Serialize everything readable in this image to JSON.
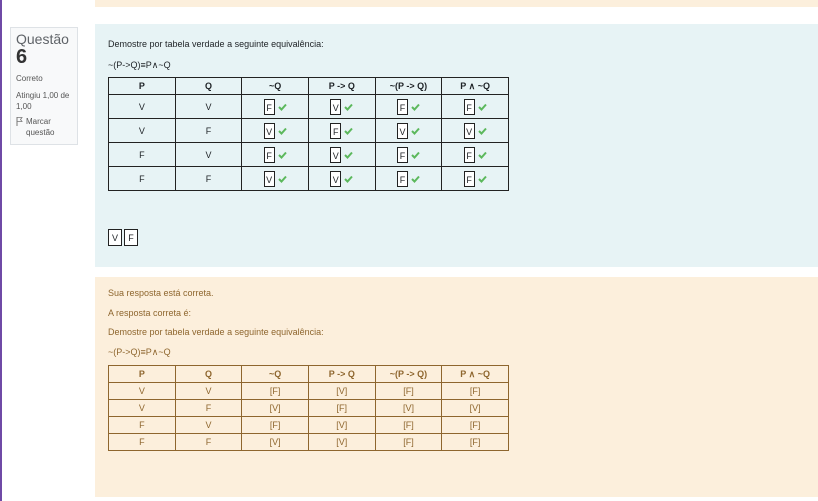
{
  "question_info": {
    "label": "Questão",
    "number": "6",
    "state": "Correto",
    "grade": "Atingiu 1,00 de 1,00",
    "flag_label": "Marcar questão",
    "flag_icon": "flag-icon"
  },
  "question": {
    "text": "Demostre por tabela verdade a seguinte equivalência:",
    "formula": "~(P->Q)≡P∧~Q",
    "headers": [
      "P",
      "Q",
      "~Q",
      "P -> Q",
      "~(P -> Q)",
      "P ∧ ~Q"
    ],
    "rows": [
      {
        "p": "V",
        "q": "V",
        "answers": [
          "F",
          "V",
          "F",
          "F"
        ]
      },
      {
        "p": "V",
        "q": "F",
        "answers": [
          "V",
          "F",
          "V",
          "V"
        ]
      },
      {
        "p": "F",
        "q": "V",
        "answers": [
          "F",
          "V",
          "F",
          "F"
        ]
      },
      {
        "p": "F",
        "q": "F",
        "answers": [
          "V",
          "V",
          "F",
          "F"
        ]
      }
    ],
    "correct_icon": "check-icon",
    "correct_color": "#5cb85c",
    "drag_items": [
      "V",
      "F"
    ]
  },
  "feedback": {
    "status": "Sua resposta está correta.",
    "correct_answer_label": "A resposta correta é:",
    "text": "Demostre por tabela verdade a seguinte equivalência:",
    "formula": "~(P->Q)≡P∧~Q",
    "headers": [
      "P",
      "Q",
      "~Q",
      "P -> Q",
      "~(P -> Q)",
      "P ∧ ~Q"
    ],
    "rows": [
      [
        "V",
        "V",
        "[F]",
        "[V]",
        "[F]",
        "[F]"
      ],
      [
        "V",
        "F",
        "[V]",
        "[F]",
        "[V]",
        "[V]"
      ],
      [
        "F",
        "V",
        "[F]",
        "[V]",
        "[F]",
        "[F]"
      ],
      [
        "F",
        "F",
        "[V]",
        "[V]",
        "[F]",
        "[F]"
      ]
    ]
  }
}
